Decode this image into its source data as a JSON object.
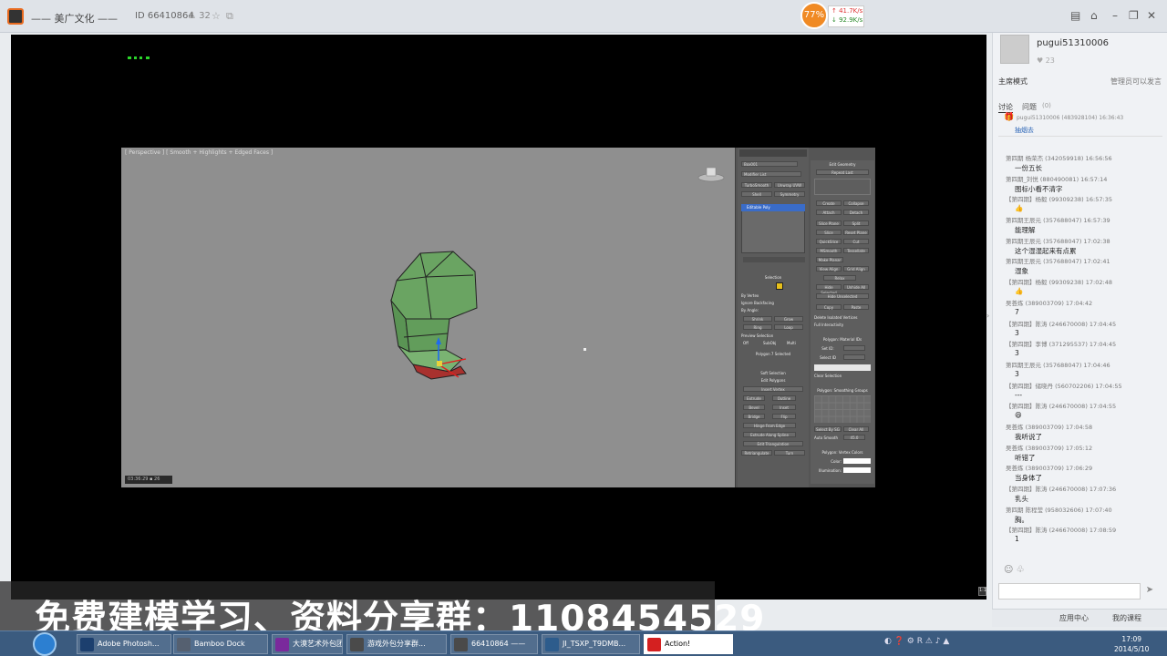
{
  "topbar": {
    "room_title": "—— 美广文化 ——",
    "room_id": "ID 66410864",
    "user_count": "32",
    "icons": [
      "app-logo",
      "user-icon",
      "star-icon",
      "share-icon",
      "list-icon",
      "home-icon",
      "minimize-icon",
      "restore-icon",
      "close-icon"
    ]
  },
  "speed": {
    "percent": "77%",
    "up": "41.7K/s",
    "down": "92.9K/s",
    "accent": "#f08a24"
  },
  "viewport": {
    "label": "[ Perspective ] [ Smooth + Highlights + Edged Faces ]",
    "status": "03:36:29 ▪ 26"
  },
  "modeling_panel": {
    "modifier_label": "Modifier List",
    "modifier_item": "Editable Poly",
    "buttons_left": [
      "TurboSmooth",
      "Unwrap UVW",
      "Shell",
      "Symmetry"
    ],
    "selection_head": "Selection",
    "selection_opts": [
      "By Vertex",
      "Ignore Backfacing",
      "By Angle:"
    ],
    "selection_btns": [
      "Shrink",
      "Grow",
      "Ring",
      "Loop"
    ],
    "preview_head": "Preview Selection",
    "preview_opts": [
      "Off",
      "SubObj",
      "Multi"
    ],
    "selected_count": "Polygon 7 Selected",
    "soft_selection": "Soft Selection",
    "edit_polygons": "Edit Polygons",
    "edit_poly_btns": [
      "Insert Vertex",
      "Extrude",
      "Outline",
      "Bevel",
      "Inset",
      "Bridge",
      "Flip",
      "Hinge From Edge",
      "Extrude Along Spline",
      "Edit Triangulation",
      "Retriangulate",
      "Turn"
    ],
    "edit_geometry": "Edit Geometry",
    "repeat_last": "Repeat Last",
    "geo_btns": [
      "Create",
      "Collapse",
      "Attach",
      "Detach",
      "Slice Plane",
      "Split",
      "Slice",
      "Reset Plane",
      "QuickSlice",
      "Cut",
      "MSmooth",
      "Tessellate",
      "Make Planar",
      "View Align",
      "Grid Align",
      "Relax",
      "Hide Selected",
      "Unhide All",
      "Hide Unselected",
      "Copy",
      "Paste"
    ],
    "delete_isolated": "Delete Isolated Vertices",
    "full_interactivity": "Full Interactivity",
    "material_ids": "Polygon: Material IDs",
    "set_id": "Set ID:",
    "select_id": "Select ID",
    "clear_selection": "Clear Selection",
    "smoothing_groups": "Polygon: Smoothing Groups",
    "select_by_sg": "Select By SG",
    "clear_all": "Clear All",
    "auto_smooth": "Auto Smooth",
    "auto_smooth_value": "45.0",
    "vertex_colors": "Polygon: Vertex Colors",
    "color": "Color:",
    "illumination": "Illumination:"
  },
  "sidebar": {
    "username": "pugui51310006",
    "likes": "23",
    "mode": "主席模式",
    "admin_note": "管理员可以发言",
    "tab_discuss": "讨论",
    "tab_question": "问题",
    "question_count": "(0)",
    "pinned_user": "pugui51310006 (483928104) 16:36:43",
    "pinned_msg": "抽烟去",
    "messages": [
      {
        "head": "第四期 杨荣杰 (342059918) 16:56:56",
        "body": "一份五长"
      },
      {
        "head": "第四期_刘悦 (880490081) 16:57:14",
        "body": "图标小看不清字"
      },
      {
        "head": "【第四期】杨毅 (99309238) 16:57:35",
        "body": "👍",
        "emoji": true
      },
      {
        "head": "第四期王辰元 (357688047) 16:57:39",
        "body": "能理解"
      },
      {
        "head": "第四期王辰元 (357688047) 17:02:38",
        "body": "这个湿湿起来有点累"
      },
      {
        "head": "第四期王辰元 (357688047) 17:02:41",
        "body": "湿象"
      },
      {
        "head": "【第四期】杨毅 (99309238) 17:02:48",
        "body": "👍",
        "emoji": true
      },
      {
        "head": "吴荟炼 (389003709) 17:04:42",
        "body": "7"
      },
      {
        "head": "【第四期】陈涛 (246670008) 17:04:45",
        "body": "3"
      },
      {
        "head": "【第四期】李博 (371295537) 17:04:45",
        "body": "3"
      },
      {
        "head": "第四期王辰元 (357688047) 17:04:46",
        "body": "3"
      },
      {
        "head": "【第四期】储晓丹 (560702206) 17:04:55",
        "body": "---"
      },
      {
        "head": "【第四期】陈涛 (246670008) 17:04:55",
        "body": "😄",
        "emoji": true
      },
      {
        "head": "吴荟炼 (389003709) 17:04:58",
        "body": "我听说了"
      },
      {
        "head": "吴荟炼 (389003709) 17:05:12",
        "body": "听错了"
      },
      {
        "head": "吴荟炼 (389003709) 17:06:29",
        "body": "当身体了"
      },
      {
        "head": "【第四期】陈涛 (246670008) 17:07:36",
        "body": "乳头"
      },
      {
        "head": "第四期 陈程莹 (958032606) 17:07:40",
        "body": "胸。"
      },
      {
        "head": "【第四期】陈涛 (246670008) 17:08:59",
        "body": "1"
      }
    ],
    "app_center": "应用中心",
    "my_course": "我的课程"
  },
  "ad_banner": "免费建模学习、资料分享群：1108454529",
  "taskbar": {
    "items": [
      {
        "label": "Adobe Photosh...",
        "color": "#1c3f6e"
      },
      {
        "label": "Bamboo Dock",
        "color": "#556070"
      },
      {
        "label": "大漠艺术外包团...",
        "color": "#7a2a9c"
      },
      {
        "label": "游戏外包分享群...",
        "color": "#4a4a4a"
      },
      {
        "label": "66410864 ——",
        "color": "#4a4a4a"
      },
      {
        "label": "JI_TSXP_T9DMB...",
        "color": "#2d5c8c"
      },
      {
        "label": "Action!",
        "color": "#d42020"
      }
    ],
    "tray": "◐ ❓ ⚙ R ⚠ ♪ ▲",
    "time": "17:09",
    "date": "2014/5/10"
  }
}
